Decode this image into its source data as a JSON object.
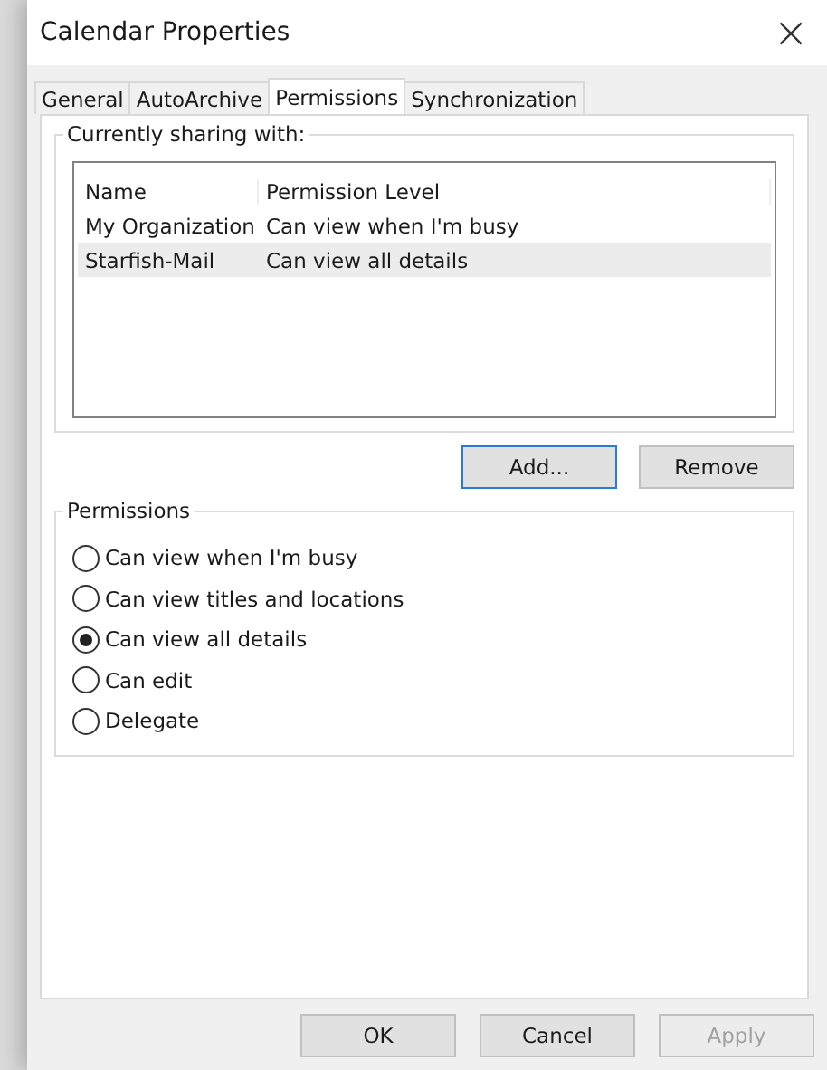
{
  "window": {
    "title": "Calendar Properties",
    "close": "×"
  },
  "tabs": [
    {
      "label": "General",
      "selected": false
    },
    {
      "label": "AutoArchive",
      "selected": false
    },
    {
      "label": "Permissions",
      "selected": true
    },
    {
      "label": "Synchronization",
      "selected": false
    }
  ],
  "sharing": {
    "title": "Currently sharing with:",
    "columns": [
      "Name",
      "Permission Level"
    ],
    "rows": [
      {
        "cells": [
          "My Organization",
          "Can view when I'm busy"
        ],
        "selected": false
      },
      {
        "cells": [
          "Starfish-Mail",
          "Can view all details"
        ],
        "selected": true
      }
    ],
    "buttons": [
      {
        "label": "Add...",
        "focused": true
      },
      {
        "label": "Remove",
        "focused": false
      }
    ]
  },
  "permissions": {
    "title": "Permissions",
    "options": [
      {
        "label": "Can view when I'm busy",
        "selected": false
      },
      {
        "label": "Can view titles and locations",
        "selected": false
      },
      {
        "label": "Can view all details",
        "selected": true
      },
      {
        "label": "Can edit",
        "selected": false
      },
      {
        "label": "Delegate",
        "selected": false
      }
    ]
  },
  "footer": [
    {
      "label": "OK",
      "disabled": false
    },
    {
      "label": "Cancel",
      "disabled": false
    },
    {
      "label": "Apply",
      "disabled": true
    }
  ]
}
